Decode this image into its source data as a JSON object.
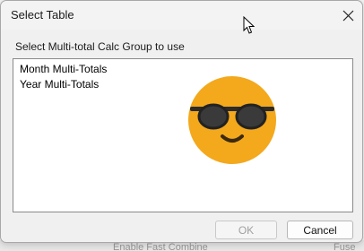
{
  "window": {
    "title": "Select Table",
    "close_icon": "close-icon"
  },
  "dialog": {
    "prompt": "Select Multi-total Calc Group to use",
    "items": [
      {
        "label": "Month Multi-Totals"
      },
      {
        "label": "Year Multi-Totals"
      }
    ],
    "ok_label": "OK",
    "cancel_label": "Cancel",
    "ok_enabled": false
  },
  "background": {
    "peek_text": "Enable Fast Combine",
    "peek_right": "Fuse"
  },
  "overlay": {
    "emoji": "sunglasses-emoji",
    "cursor": "mouse-pointer-icon"
  },
  "colors": {
    "dialog_bg": "#f0f0f0",
    "listbox_bg": "#ffffff",
    "emoji_face": "#f4a81c",
    "disabled_text": "#a0a0a0"
  }
}
